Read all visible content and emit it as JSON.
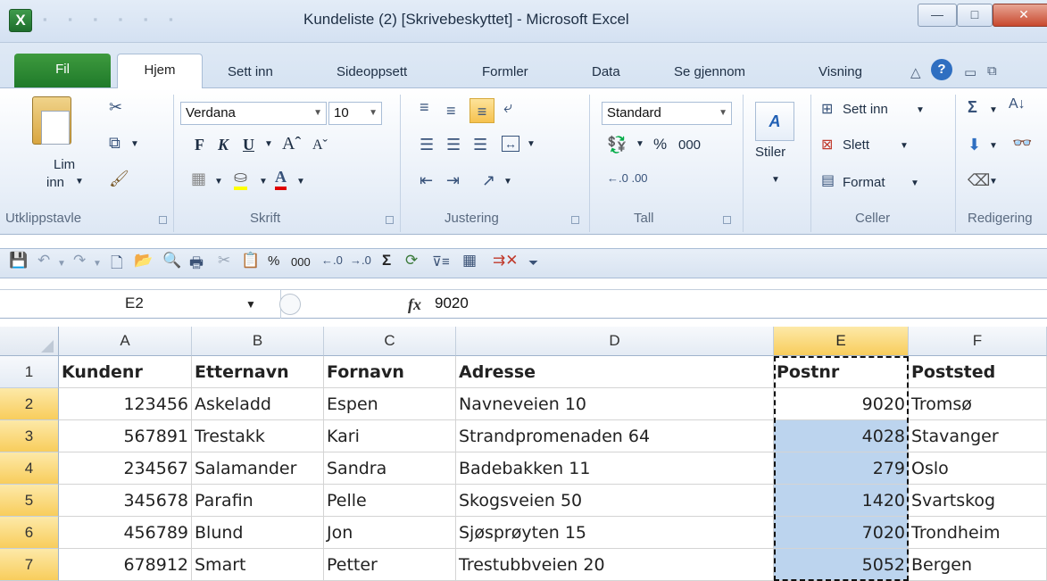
{
  "window": {
    "title": "Kundeliste (2)  [Skrivebeskyttet]  -  Microsoft Excel",
    "app_icon_letter": "X",
    "min_glyph": "—",
    "max_glyph": "□",
    "close_glyph": "✕"
  },
  "tabs": {
    "file": "Fil",
    "items": [
      "Hjem",
      "Sett inn",
      "Sideoppsett",
      "Formler",
      "Data",
      "Se gjennom",
      "Visning"
    ],
    "right_icons": [
      "collapse-ribbon-icon",
      "help-icon",
      "minimize-icon",
      "restore-icon"
    ]
  },
  "ribbon": {
    "clipboard": {
      "label": "Utklippstavle",
      "paste_line1": "Lim",
      "paste_line2": "inn"
    },
    "font": {
      "label": "Skrift",
      "font_name": "Verdana",
      "font_size": "10",
      "bold": "F",
      "italic": "K",
      "underline": "U"
    },
    "alignment": {
      "label": "Justering"
    },
    "number": {
      "label": "Tall",
      "format": "Standard",
      "percent": "%",
      "thousands": "000"
    },
    "styles": {
      "label": "Stiler"
    },
    "cells": {
      "label": "Celler",
      "insert": "Sett inn",
      "delete": "Slett",
      "format": "Format"
    },
    "editing": {
      "label": "Redigering"
    }
  },
  "quick_toolbar": {
    "percent": "%",
    "thousands": "000",
    "icons": [
      "save-icon",
      "undo-icon",
      "redo-icon",
      "new-icon",
      "open-icon",
      "print-preview-icon",
      "print-icon",
      "cut-icon",
      "paste-values-icon",
      "percent-icon",
      "thousands-icon",
      "increase-decimal-icon",
      "decrease-decimal-icon",
      "autosum-icon",
      "refresh-icon",
      "filter-icon",
      "freeze-icon",
      "delete-column-icon",
      "customize-icon"
    ]
  },
  "formula_bar": {
    "name_box": "E2",
    "fx": "fx",
    "value": "9020"
  },
  "sheet": {
    "columns": [
      "A",
      "B",
      "C",
      "D",
      "E",
      "F"
    ],
    "active_column": "E",
    "headers": [
      "Kundenr",
      "Etternavn",
      "Fornavn",
      "Adresse",
      "Postnr",
      "Poststed"
    ],
    "rows": [
      {
        "num": "2",
        "cells": [
          "123456",
          "Askeladd",
          "Espen",
          "Navneveien 10",
          "9020",
          "Tromsø"
        ]
      },
      {
        "num": "3",
        "cells": [
          "567891",
          "Trestakk",
          "Kari",
          "Strandpromenaden 64",
          "4028",
          "Stavanger"
        ]
      },
      {
        "num": "4",
        "cells": [
          "234567",
          "Salamander",
          "Sandra",
          "Badebakken 11",
          "279",
          "Oslo"
        ]
      },
      {
        "num": "5",
        "cells": [
          "345678",
          "Parafin",
          "Pelle",
          "Skogsveien 50",
          "1420",
          "Svartskog"
        ]
      },
      {
        "num": "6",
        "cells": [
          "456789",
          "Blund",
          "Jon",
          "Sjøsprøyten 15",
          "7020",
          "Trondheim"
        ]
      },
      {
        "num": "7",
        "cells": [
          "678912",
          "Smart",
          "Petter",
          "Trestubbveien 20",
          "5052",
          "Bergen"
        ]
      }
    ],
    "header_row_num": "1"
  },
  "colors": {
    "file_tab": "#2a8a35",
    "selection": "#bcd4ee",
    "active_header": "#f8cd5c"
  }
}
